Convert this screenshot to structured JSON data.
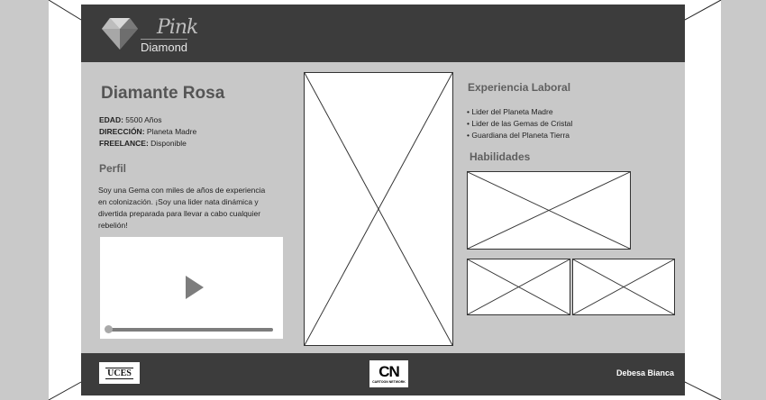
{
  "brand": {
    "script": "Pink",
    "word": "Diamond"
  },
  "profile": {
    "name": "Diamante Rosa",
    "edad_label": "EDAD:",
    "edad_value": "5500 Años",
    "direccion_label": "DIRECCIÓN:",
    "direccion_value": "Planeta Madre",
    "freelance_label": "FREELANCE:",
    "freelance_value": "Disponible",
    "perfil_title": "Perfil",
    "bio": "Soy una Gema con miles de años de experiencia en colonización. ¡Soy una lider nata dinámica y divertida preparada para llevar a cabo cualquier rebelión!"
  },
  "experience": {
    "title": "Experiencia Laboral",
    "items": [
      "• Lider del Planeta Madre",
      "• Lider de las Gemas de Cristal",
      "• Guardiana del Planeta Tierra"
    ]
  },
  "skills": {
    "title": "Habilidades"
  },
  "video": {
    "progress": 0
  },
  "footer": {
    "left_logo": "UCES",
    "center_logo": "CN",
    "center_logo_sub": "CARTOON NETWORK",
    "author": "Debesa Bianca"
  },
  "colors": {
    "header": "#3c3c3c",
    "panel": "#c8c8c8",
    "sides": "#c9c9c9",
    "title_gray": "#555555"
  }
}
